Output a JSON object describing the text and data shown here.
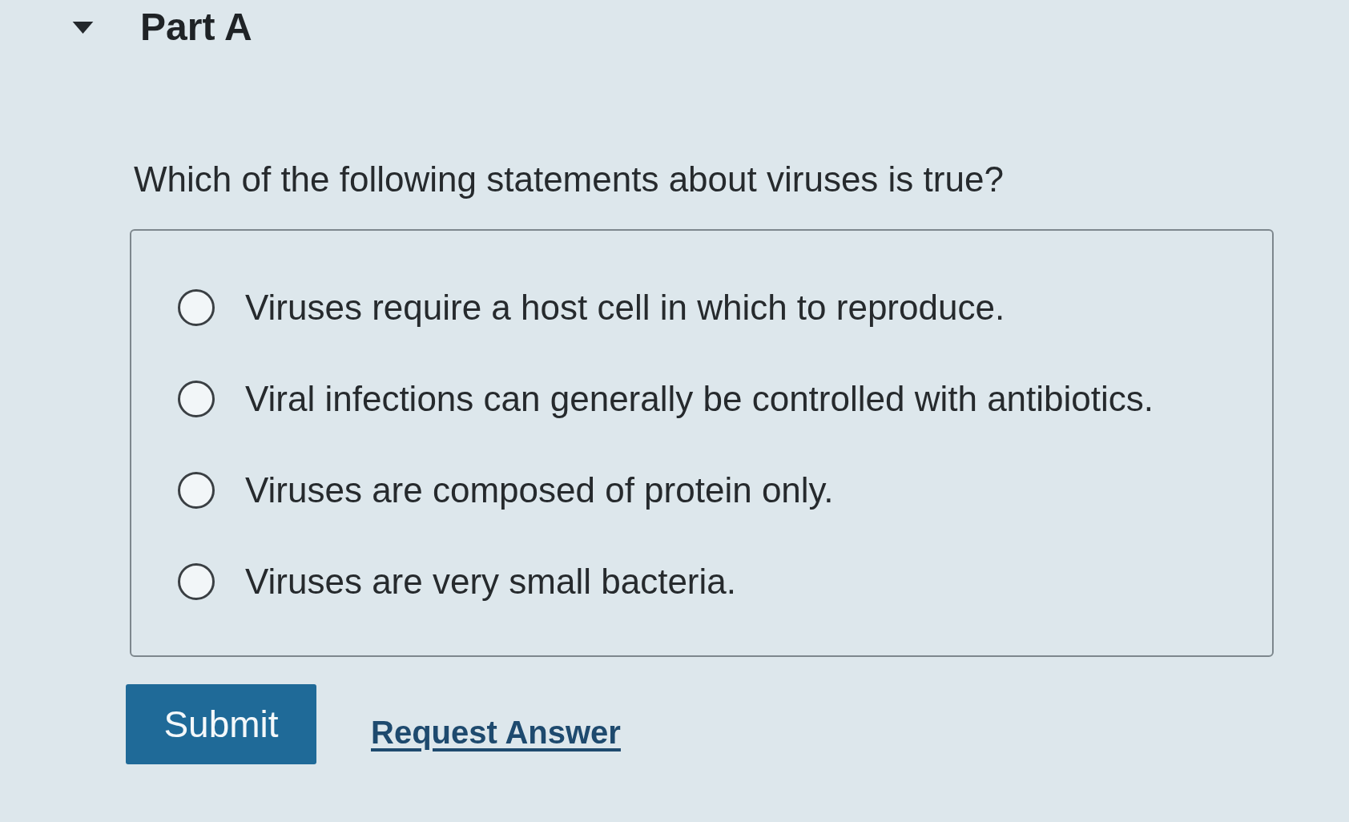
{
  "part": {
    "title": "Part A",
    "expanded": true
  },
  "question": "Which of the following statements about viruses is true?",
  "options": [
    {
      "label": "Viruses require a host cell in which to reproduce.",
      "selected": false
    },
    {
      "label": "Viral infections can generally be controlled with antibiotics.",
      "selected": false
    },
    {
      "label": "Viruses are composed of protein only.",
      "selected": false
    },
    {
      "label": "Viruses are very small bacteria.",
      "selected": false
    }
  ],
  "actions": {
    "submit": "Submit",
    "request_answer": "Request Answer"
  }
}
